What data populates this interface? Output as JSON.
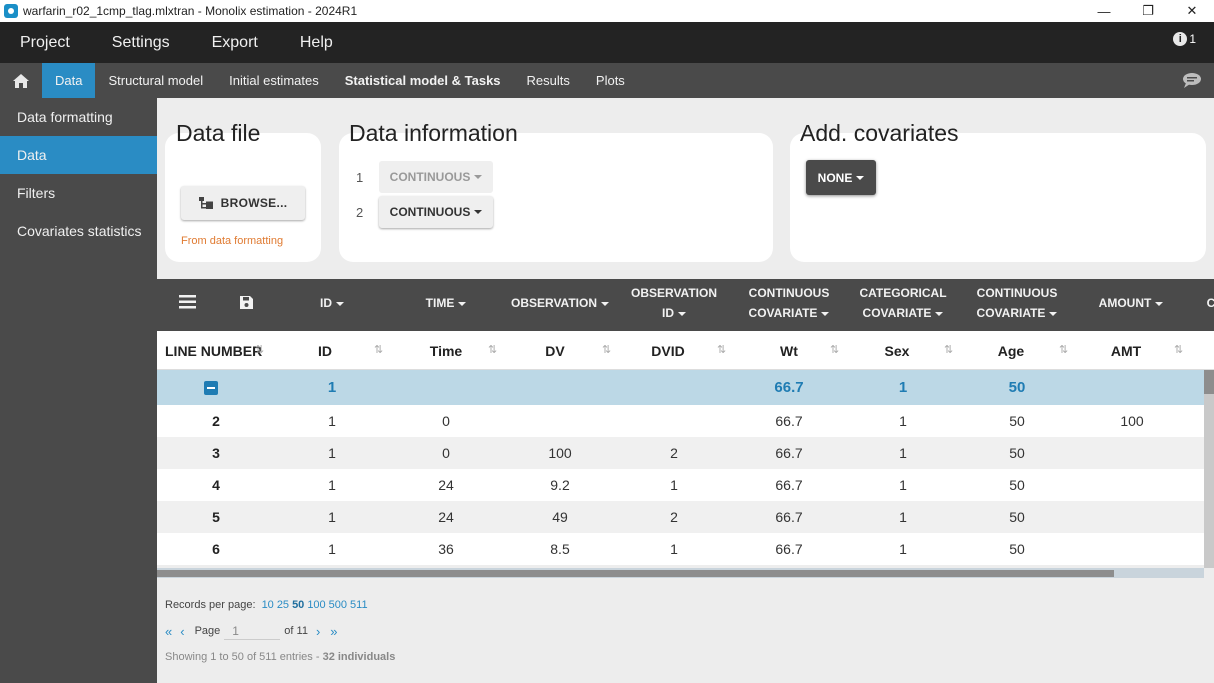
{
  "window": {
    "title": "warfarin_r02_1cmp_tlag.mlxtran - Monolix estimation - 2024R1",
    "minimize": "—",
    "maximize": "❐",
    "close": "✕"
  },
  "menu": {
    "items": [
      "Project",
      "Settings",
      "Export",
      "Help"
    ],
    "notifications": "1"
  },
  "tabs": [
    "Data",
    "Structural model",
    "Initial estimates",
    "Statistical model & Tasks",
    "Results",
    "Plots"
  ],
  "active_tab": "Data",
  "sidebar": {
    "items": [
      "Data formatting",
      "Data",
      "Filters",
      "Covariates statistics"
    ],
    "active": "Data"
  },
  "data_file": {
    "title": "Data file",
    "browse_label": "BROWSE...",
    "source": "From data formatting"
  },
  "data_information": {
    "title": "Data information",
    "rows": [
      {
        "num": "1",
        "type": "CONTINUOUS",
        "disabled": true
      },
      {
        "num": "2",
        "type": "CONTINUOUS",
        "disabled": false
      }
    ]
  },
  "add_covariates": {
    "title": "Add. covariates",
    "button": "NONE"
  },
  "table": {
    "column_types": [
      {
        "line1": "ID",
        "line2": "",
        "caret": true
      },
      {
        "line1": "TIME",
        "line2": "",
        "caret": true
      },
      {
        "line1": "OBSERVATION",
        "line2": "",
        "caret": true
      },
      {
        "line1": "OBSERVATION",
        "line2": "ID",
        "caret": true
      },
      {
        "line1": "CONTINUOUS",
        "line2": "COVARIATE",
        "caret": true
      },
      {
        "line1": "CATEGORICAL",
        "line2": "COVARIATE",
        "caret": true
      },
      {
        "line1": "CONTINUOUS",
        "line2": "COVARIATE",
        "caret": true
      },
      {
        "line1": "AMOUNT",
        "line2": "",
        "caret": true
      },
      {
        "line1": "C",
        "line2": "",
        "caret": false
      }
    ],
    "line_number_header": "LINE NUMBER",
    "column_names": [
      "ID",
      "Time",
      "DV",
      "DVID",
      "Wt",
      "Sex",
      "Age",
      "AMT"
    ],
    "group_row": {
      "id": "1",
      "wt": "66.7",
      "sex": "1",
      "age": "50"
    },
    "rows": [
      {
        "line": "2",
        "cells": [
          "1",
          "0",
          "",
          "",
          "66.7",
          "1",
          "50",
          "100"
        ]
      },
      {
        "line": "3",
        "cells": [
          "1",
          "0",
          "100",
          "2",
          "66.7",
          "1",
          "50",
          ""
        ]
      },
      {
        "line": "4",
        "cells": [
          "1",
          "24",
          "9.2",
          "1",
          "66.7",
          "1",
          "50",
          ""
        ]
      },
      {
        "line": "5",
        "cells": [
          "1",
          "24",
          "49",
          "2",
          "66.7",
          "1",
          "50",
          ""
        ]
      },
      {
        "line": "6",
        "cells": [
          "1",
          "36",
          "8.5",
          "1",
          "66.7",
          "1",
          "50",
          ""
        ]
      }
    ]
  },
  "footer": {
    "records_label": "Records per page:",
    "records_options": [
      "10",
      "25",
      "50",
      "100",
      "500",
      "511"
    ],
    "records_selected": "50",
    "page_label": "Page",
    "page_value": "1",
    "of_label": "of 11",
    "showing": "Showing 1 to 50 of 511 entries -",
    "individuals": "32 individuals"
  }
}
